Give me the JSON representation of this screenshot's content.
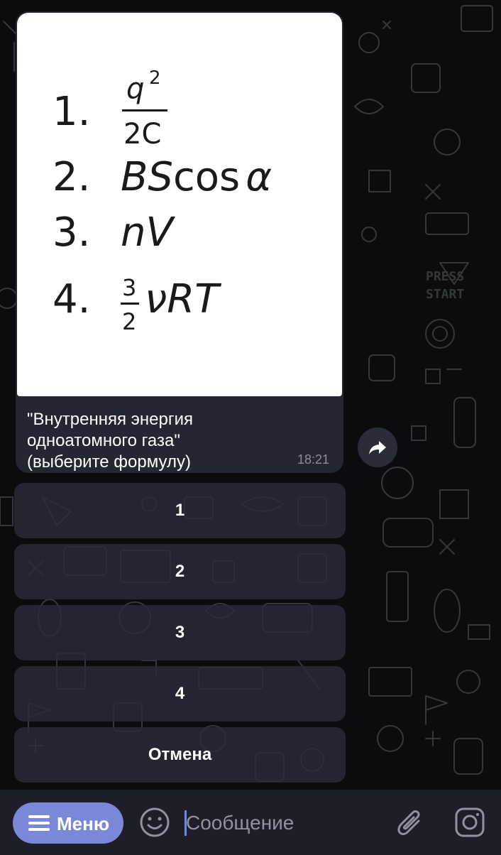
{
  "chat": {
    "message": {
      "caption_lines": [
        "\"Внутренняя энергия",
        "одноатомного газа\"",
        "(выберите формулу)"
      ],
      "time": "18:21",
      "formulas": [
        {
          "number": "1.",
          "numerator": "q",
          "exponent": "2",
          "denominator": "2C"
        },
        {
          "number": "2.",
          "main": "BS",
          "func": "cos",
          "arg": "α"
        },
        {
          "number": "3.",
          "main": "nV"
        },
        {
          "number": "4.",
          "numerator": "3",
          "denominator": "2",
          "main": "νRT"
        }
      ]
    },
    "keyboard": [
      {
        "label": "1"
      },
      {
        "label": "2"
      },
      {
        "label": "3"
      },
      {
        "label": "4"
      },
      {
        "label": "Отмена"
      }
    ]
  },
  "bottom_bar": {
    "menu_label": "Меню",
    "input_placeholder": "Сообщение"
  },
  "icons": {
    "forward": "forward-arrow-icon",
    "menu": "hamburger-icon",
    "emoji": "smile-icon",
    "attach": "paperclip-icon",
    "camera": "camera-icon"
  },
  "colors": {
    "background": "#0c0c10",
    "bubble": "#242631",
    "accent": "#7b88d9",
    "button": "#2c2a38"
  }
}
